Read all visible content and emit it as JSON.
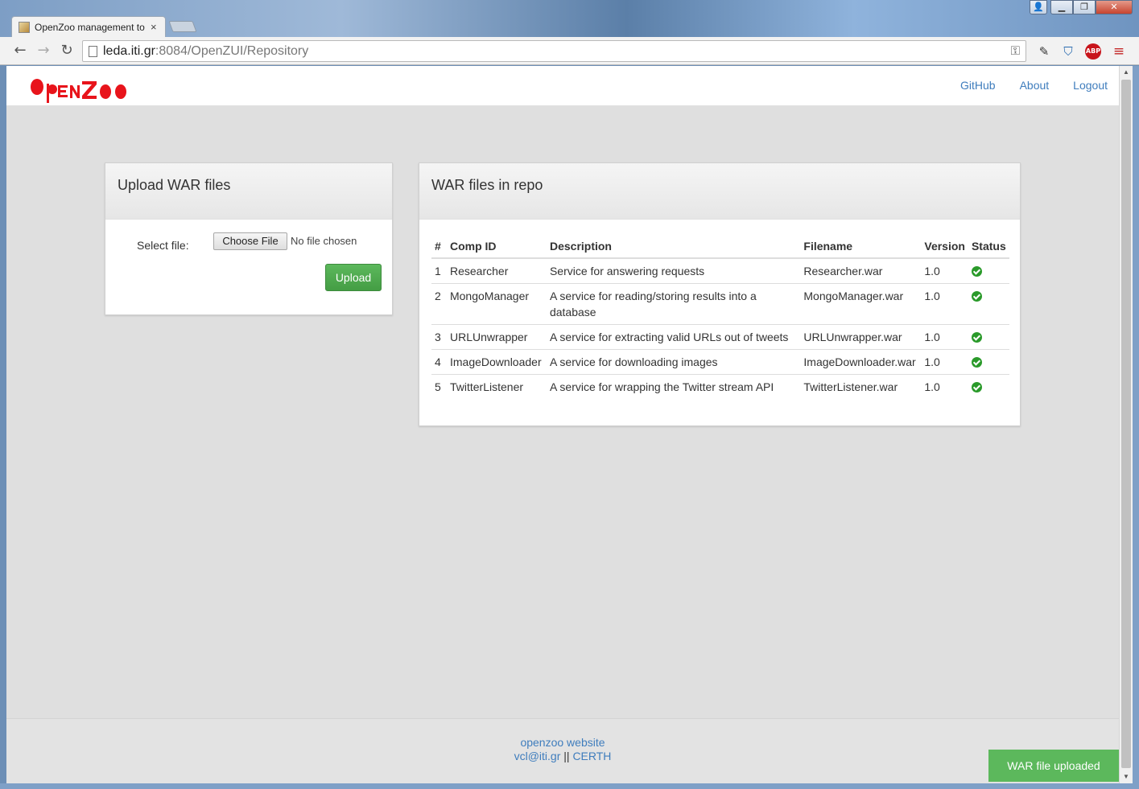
{
  "browser": {
    "tab_title": "OpenZoo management to",
    "tab_close": "×",
    "url_host": "leda.iti.gr",
    "url_rest": ":8084/OpenZUI/Repository",
    "back_glyph": "←",
    "forward_glyph": "→",
    "reload_glyph": "↻",
    "abp_label": "ABP",
    "window_buttons": {
      "user": "👤",
      "minimize": "▁",
      "maximize": "❐",
      "close": "✕"
    }
  },
  "nav": {
    "brand": "OpenZoo",
    "links": [
      "GitHub",
      "About",
      "Logout"
    ]
  },
  "upload": {
    "title": "Upload WAR files",
    "select_label": "Select file:",
    "choose_button": "Choose File",
    "file_status": "No file chosen",
    "upload_button": "Upload"
  },
  "repo": {
    "title": "WAR files in repo",
    "columns": [
      "#",
      "Comp ID",
      "Description",
      "Filename",
      "Version",
      "Status"
    ],
    "rows": [
      {
        "num": "1",
        "comp_id": "Researcher",
        "description": "Service for answering requests",
        "filename": "Researcher.war",
        "version": "1.0",
        "status": "ok"
      },
      {
        "num": "2",
        "comp_id": "MongoManager",
        "description": "A service for reading/storing results into a database",
        "filename": "MongoManager.war",
        "version": "1.0",
        "status": "ok"
      },
      {
        "num": "3",
        "comp_id": "URLUnwrapper",
        "description": "A service for extracting valid URLs out of tweets",
        "filename": "URLUnwrapper.war",
        "version": "1.0",
        "status": "ok"
      },
      {
        "num": "4",
        "comp_id": "ImageDownloader",
        "description": "A service for downloading images",
        "filename": "ImageDownloader.war",
        "version": "1.0",
        "status": "ok"
      },
      {
        "num": "5",
        "comp_id": "TwitterListener",
        "description": "A service for wrapping the Twitter stream API",
        "filename": "TwitterListener.war",
        "version": "1.0",
        "status": "ok"
      }
    ]
  },
  "footer": {
    "website_link": "openzoo website",
    "email_link": "vcl@iti.gr",
    "separator": "||",
    "org_link": "CERTH"
  },
  "toast": {
    "message": "WAR file uploaded"
  },
  "colors": {
    "accent_green": "#5cb85c",
    "link_blue": "#3f7dbd",
    "brand_red": "#e8141b",
    "status_ok": "#2a9a2a"
  }
}
